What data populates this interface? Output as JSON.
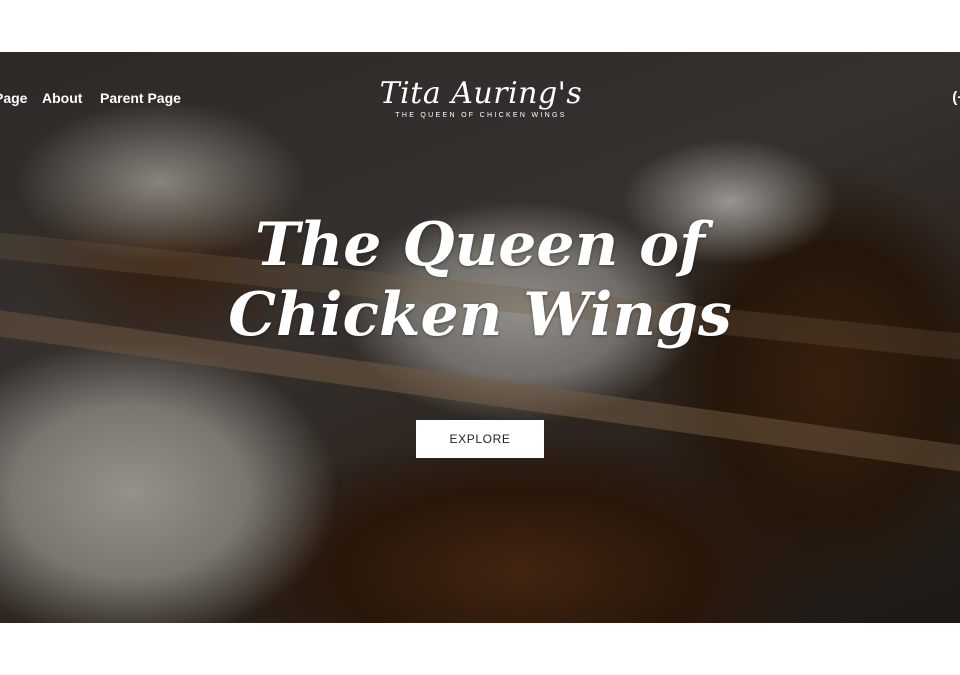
{
  "nav": {
    "items": [
      "Page",
      "About",
      "Parent Page"
    ],
    "right_label": "(+"
  },
  "logo": {
    "script_text": "Tita Auring's",
    "tagline": "THE QUEEN OF CHICKEN WINGS"
  },
  "hero": {
    "headline": "The Queen of Chicken Wings",
    "cta_label": "EXPLORE"
  },
  "colors": {
    "page_background": "#ffffff",
    "text_on_hero": "#ffffff",
    "cta_background": "#ffffff",
    "cta_text": "#222222"
  }
}
